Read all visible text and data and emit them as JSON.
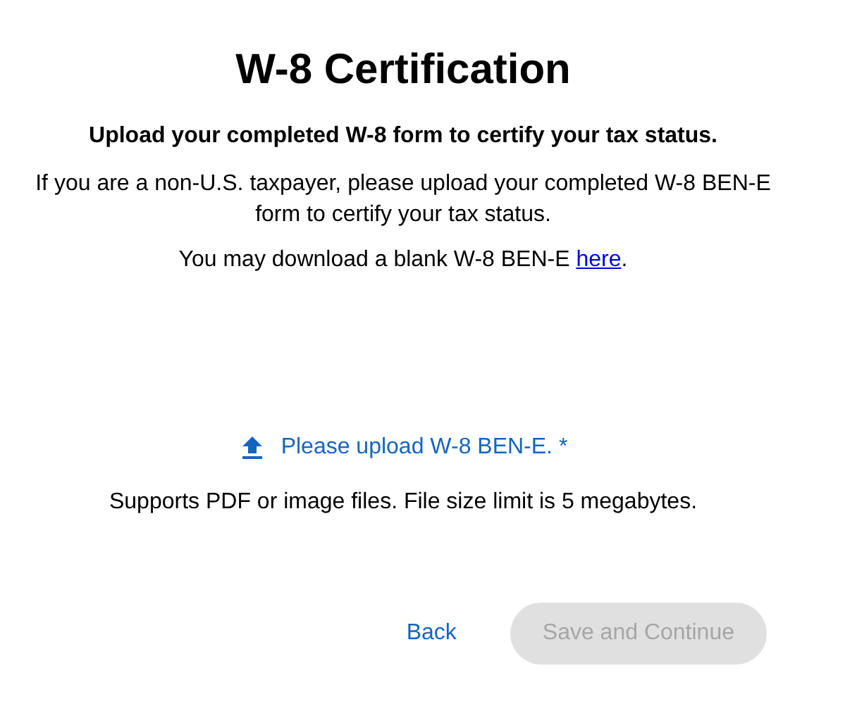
{
  "title": "W-8 Certification",
  "subtitle": "Upload your completed W-8 form to certify your tax status.",
  "description": "If you are a non-U.S. taxpayer, please upload your completed W-8 BEN-E form to certify your tax status.",
  "download": {
    "text": "You may download a blank W-8 BEN-E",
    "link": "here",
    "suffix": "."
  },
  "upload": {
    "label": "Please upload W-8 BEN-E. *"
  },
  "hint": "Supports PDF or image files. File size limit is 5 megabytes.",
  "buttons": [
    {
      "label": "Back",
      "kind": "link",
      "disabled": false
    },
    {
      "label": "Save and Continue",
      "kind": "primary",
      "disabled": true
    }
  ]
}
